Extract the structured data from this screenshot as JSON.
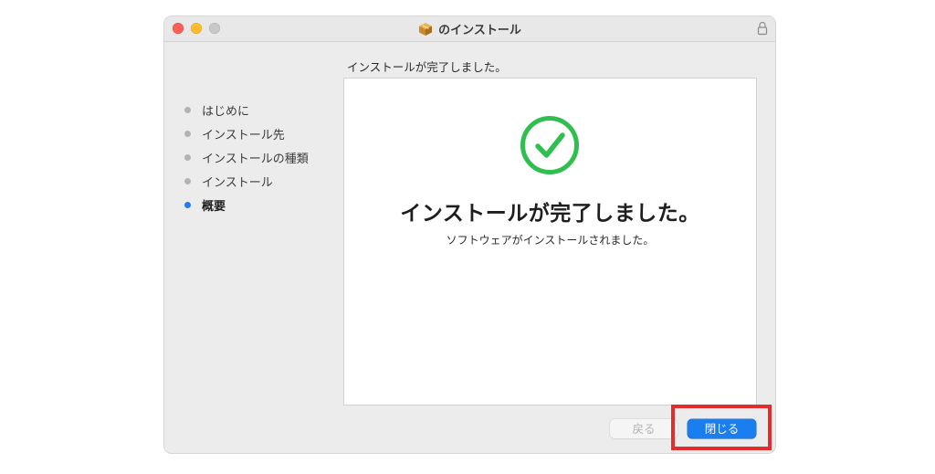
{
  "window": {
    "title": "のインストール",
    "icon": "package-icon",
    "lock_icon": "lock-icon"
  },
  "heading": "インストールが完了しました。",
  "sidebar": {
    "steps": [
      {
        "label": "はじめに",
        "current": false
      },
      {
        "label": "インストール先",
        "current": false
      },
      {
        "label": "インストールの種類",
        "current": false
      },
      {
        "label": "インストール",
        "current": false
      },
      {
        "label": "概要",
        "current": true
      }
    ]
  },
  "panel": {
    "icon": "checkmark-icon",
    "title": "インストールが完了しました。",
    "message": "ソフトウェアがインストールされました。"
  },
  "buttons": {
    "back_label": "戻る",
    "close_label": "閉じる"
  },
  "colors": {
    "accent": "#1a7df0",
    "success": "#2fbf4e",
    "highlight": "#e32c2c"
  }
}
